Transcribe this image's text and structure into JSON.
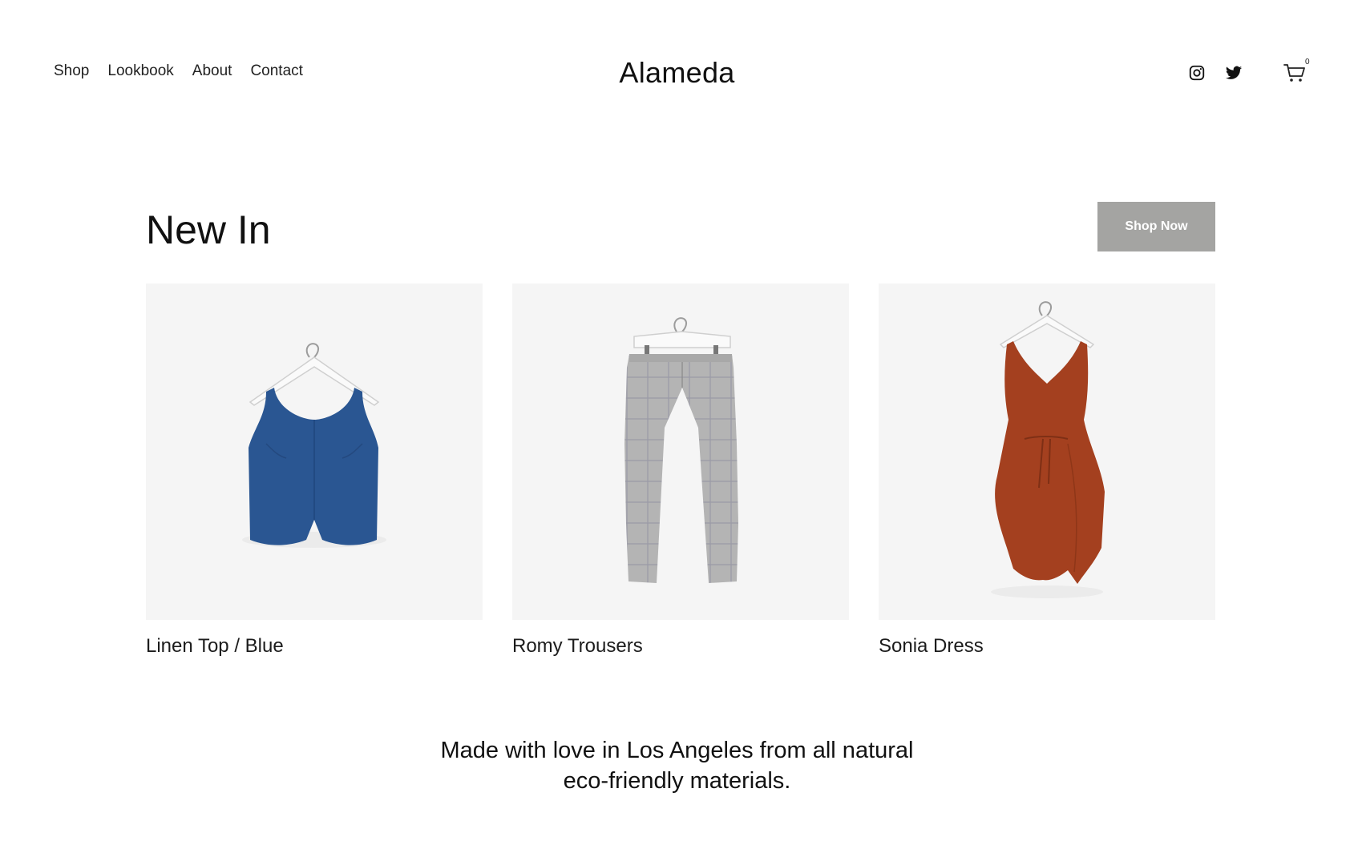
{
  "header": {
    "nav": [
      "Shop",
      "Lookbook",
      "About",
      "Contact"
    ],
    "brand": "Alameda",
    "social_icons": [
      "instagram-icon",
      "twitter-icon"
    ],
    "cart": {
      "icon": "cart-icon",
      "count": "0"
    }
  },
  "new_in": {
    "title": "New In",
    "button_label": "Shop Now",
    "button_color": "#a4a4a2",
    "products": [
      {
        "name": "Linen Top / Blue",
        "color": "#2a5692"
      },
      {
        "name": "Romy Trousers",
        "color": "#a9a9a9"
      },
      {
        "name": "Sonia Dress",
        "color": "#a4401f"
      }
    ]
  },
  "footer": {
    "tagline_line1": "Made with love in Los Angeles from all natural",
    "tagline_line2": "eco-friendly materials."
  }
}
